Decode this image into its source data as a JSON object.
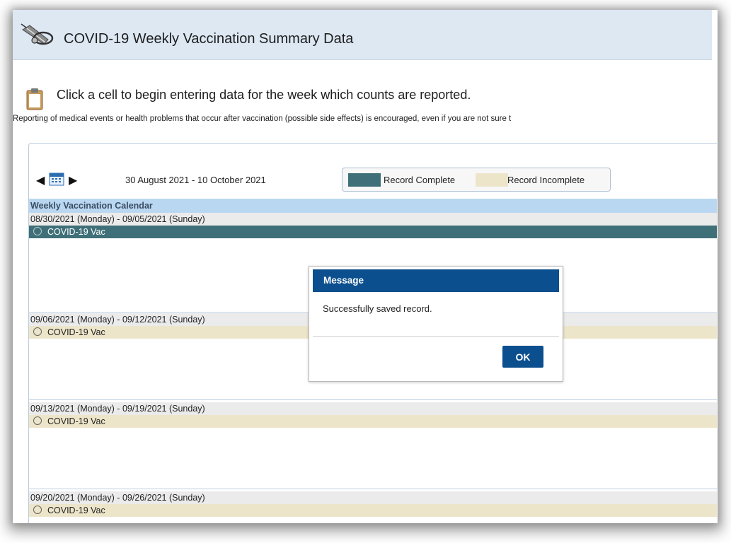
{
  "header": {
    "title": "COVID-19 Weekly Vaccination Summary Data",
    "logo_icon": "syringe-stethoscope-icon"
  },
  "instruction": "Click a cell to begin entering data for the week which counts are reported.",
  "note": "Reporting of medical events or health problems that occur after vaccination (possible side effects) is encouraged, even if you are not sure t",
  "calendar": {
    "range": "30 August 2021  -  10 October 2021",
    "legend": {
      "complete": "Record Complete",
      "incomplete": "Record Incomplete",
      "complete_color": "#3f6f78",
      "incomplete_color": "#ede5ca"
    },
    "heading": "Weekly Vaccination Calendar",
    "weeks": [
      {
        "range": "08/30/2021 (Monday) - 09/05/2021 (Sunday)",
        "item": "COVID-19 Vac",
        "status": "complete"
      },
      {
        "range": "09/06/2021 (Monday) - 09/12/2021 (Sunday)",
        "item": "COVID-19 Vac",
        "status": "incomplete"
      },
      {
        "range": "09/13/2021 (Monday) - 09/19/2021 (Sunday)",
        "item": "COVID-19 Vac",
        "status": "incomplete"
      },
      {
        "range": "09/20/2021 (Monday) - 09/26/2021 (Sunday)",
        "item": "COVID-19 Vac",
        "status": "incomplete"
      }
    ]
  },
  "modal": {
    "title": "Message",
    "message": "Successfully saved record.",
    "ok_label": "OK"
  }
}
